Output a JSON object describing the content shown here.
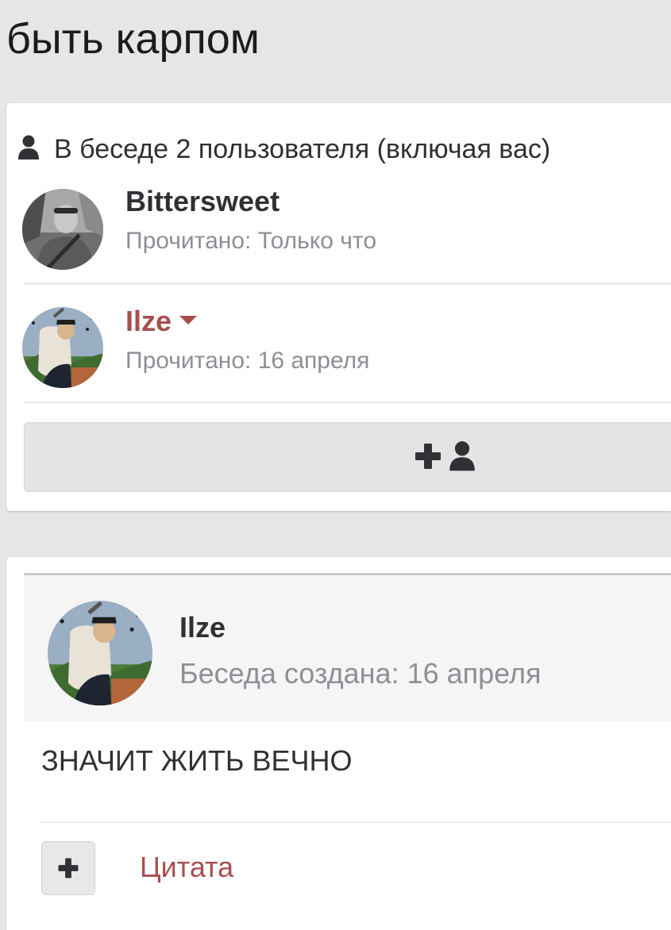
{
  "page": {
    "title": "быть карпом"
  },
  "participants": {
    "header_icon": "user-icon",
    "header_text": "В беседе 2 пользователя (включая вас)",
    "items": [
      {
        "name": "Bittersweet",
        "read_status": "Прочитано: Только что",
        "avatar": "avatar-photo-grayscale"
      },
      {
        "name": "Ilze",
        "read_status": "Прочитано: 16 апреля",
        "avatar": "avatar-painting",
        "has_menu": true,
        "menu_icon": "caret-down-icon"
      }
    ],
    "add_button_icons": [
      "plus-icon",
      "user-icon"
    ]
  },
  "message": {
    "author": "Ilze",
    "created": "Беседа создана: 16 апреля",
    "body": "ЗНАЧИТ ЖИТЬ ВЕЧНО",
    "quote_icon": "plus-icon",
    "quote_label": "Цитата"
  },
  "colors": {
    "background": "#e6e6e6",
    "card": "#ffffff",
    "text": "#2f3135",
    "muted": "#8c9096",
    "accent": "#a5504f"
  }
}
